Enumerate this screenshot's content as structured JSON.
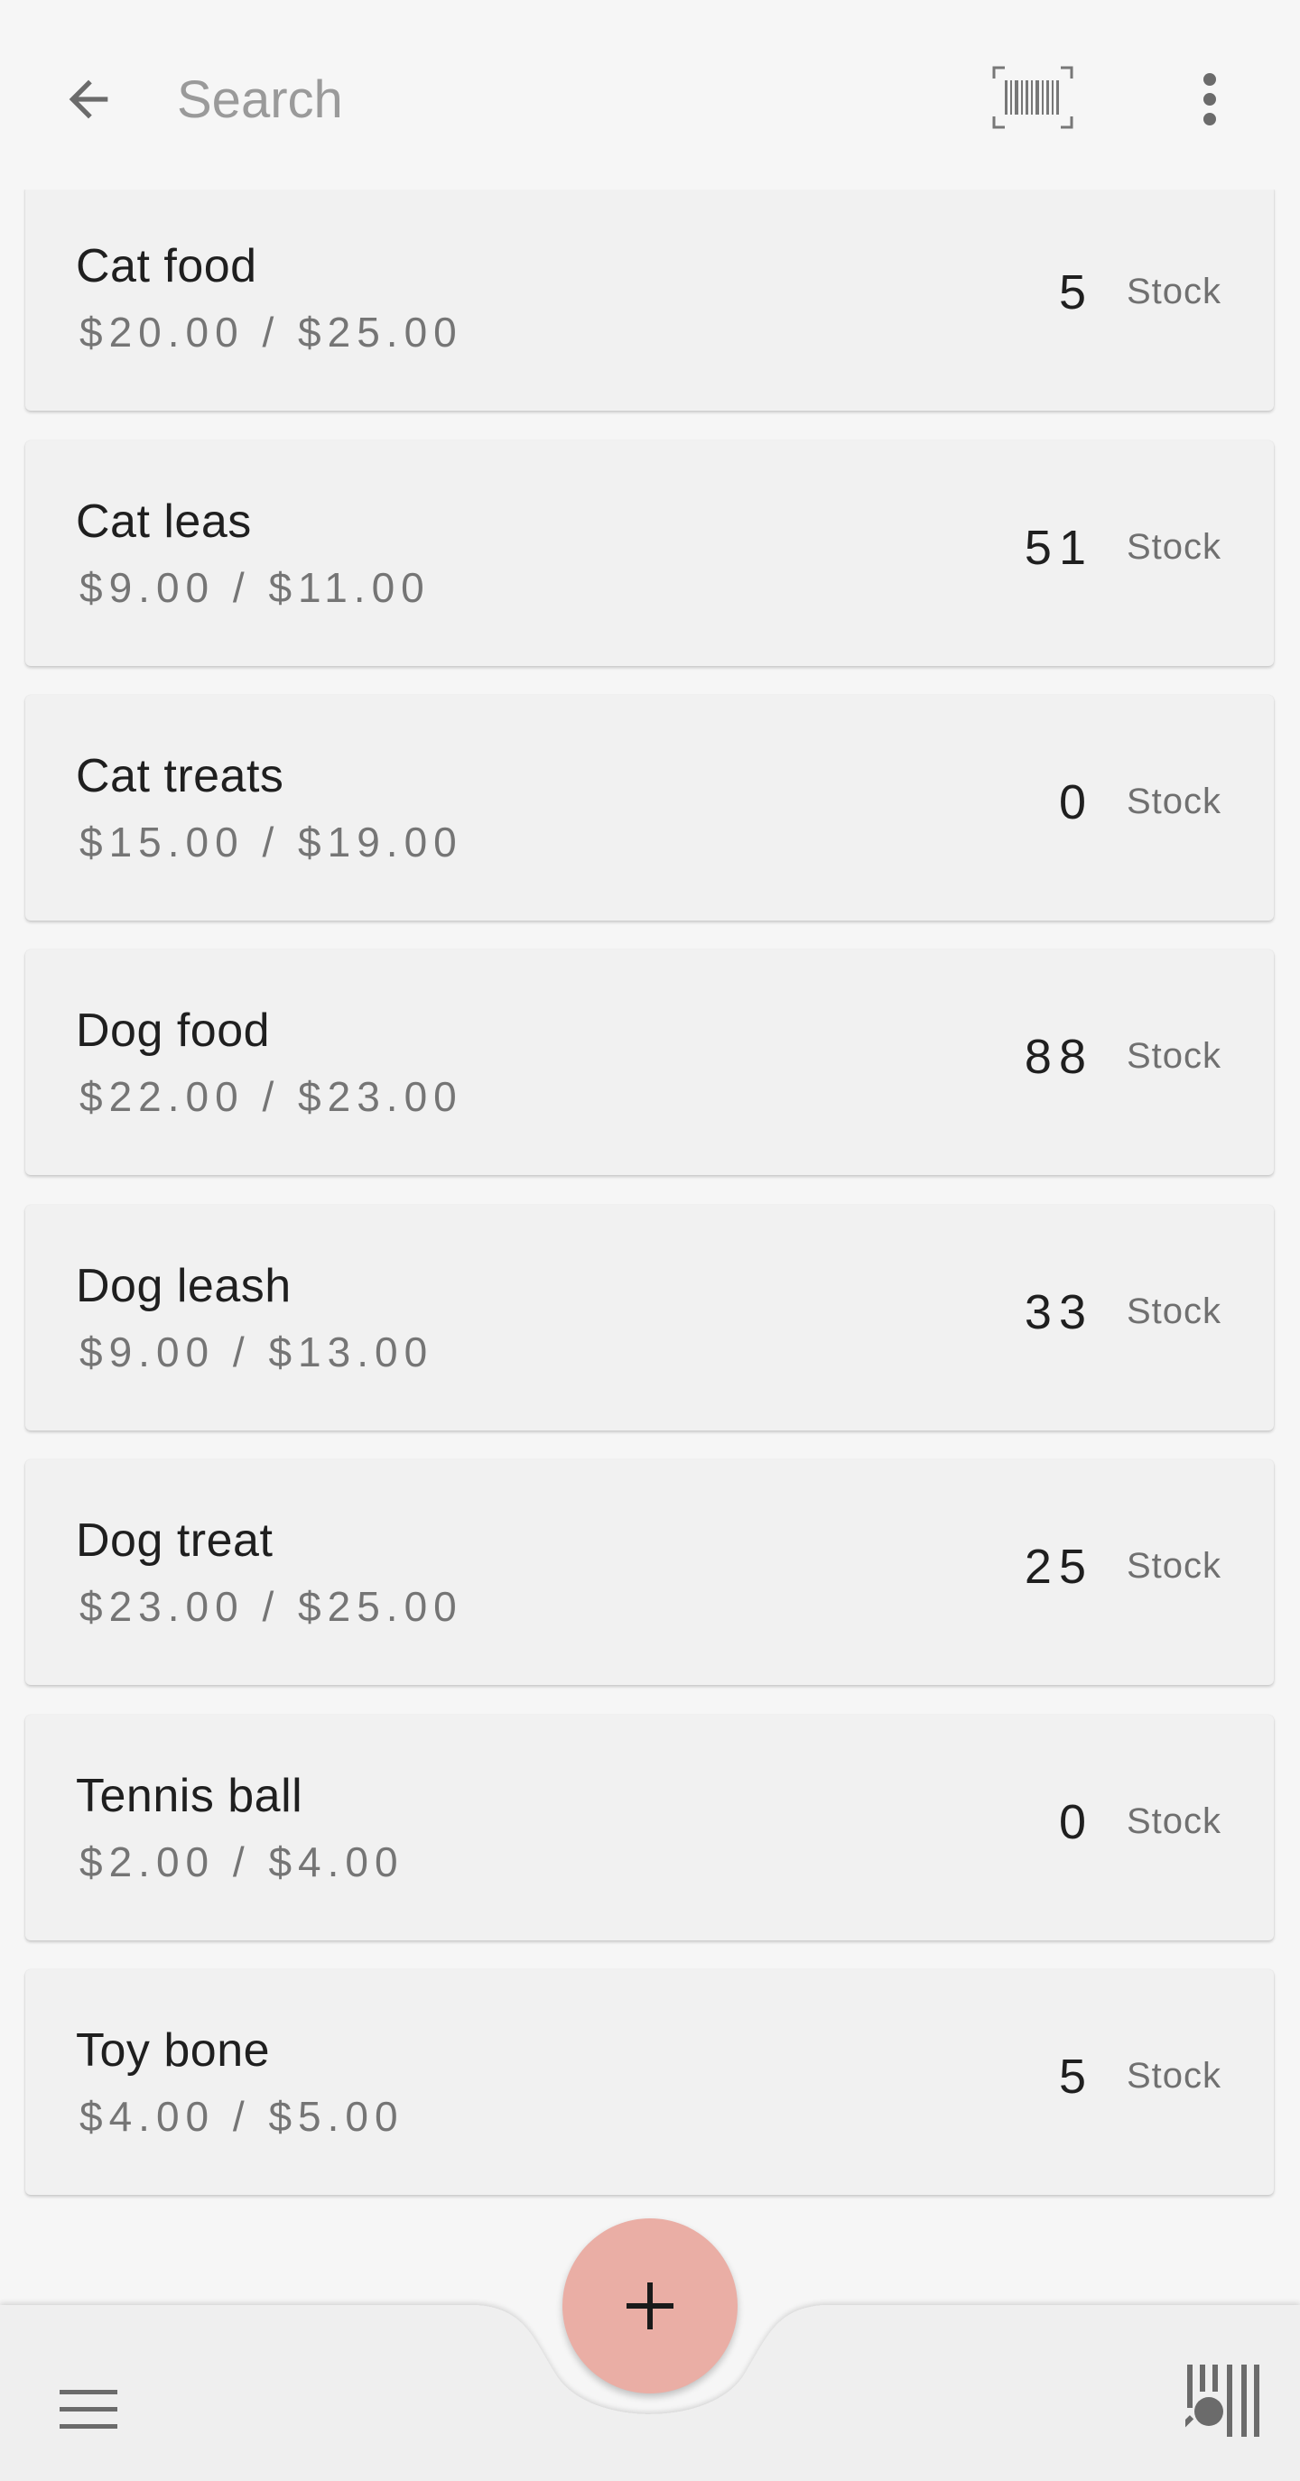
{
  "search": {
    "placeholder": "Search",
    "value": ""
  },
  "icons": {
    "back": "arrow-back-icon",
    "barcode": "barcode-icon",
    "overflow": "more-vert-icon",
    "menu": "hamburger-menu-icon",
    "add": "plus-icon",
    "scan": "barcode-scan-icon"
  },
  "items": [
    {
      "name": "Cat food",
      "price": "$20.00 / $25.00",
      "qty": "5",
      "stock_label": "Stock"
    },
    {
      "name": "Cat leas",
      "price": "$9.00 / $11.00",
      "qty": "51",
      "stock_label": "Stock"
    },
    {
      "name": "Cat treats",
      "price": "$15.00 / $19.00",
      "qty": "0",
      "stock_label": "Stock"
    },
    {
      "name": "Dog food",
      "price": "$22.00 / $23.00",
      "qty": "88",
      "stock_label": "Stock"
    },
    {
      "name": "Dog leash",
      "price": "$9.00 / $13.00",
      "qty": "33",
      "stock_label": "Stock"
    },
    {
      "name": "Dog treat",
      "price": "$23.00 / $25.00",
      "qty": "25",
      "stock_label": "Stock"
    },
    {
      "name": "Tennis ball",
      "price": "$2.00 / $4.00",
      "qty": "0",
      "stock_label": "Stock"
    },
    {
      "name": "Toy bone",
      "price": "$4.00 / $5.00",
      "qty": "5",
      "stock_label": "Stock"
    }
  ],
  "colors": {
    "background": "#f6f6f6",
    "card": "#f1f1f1",
    "fab": "#eaaea5",
    "icon": "#6b6b6b"
  }
}
